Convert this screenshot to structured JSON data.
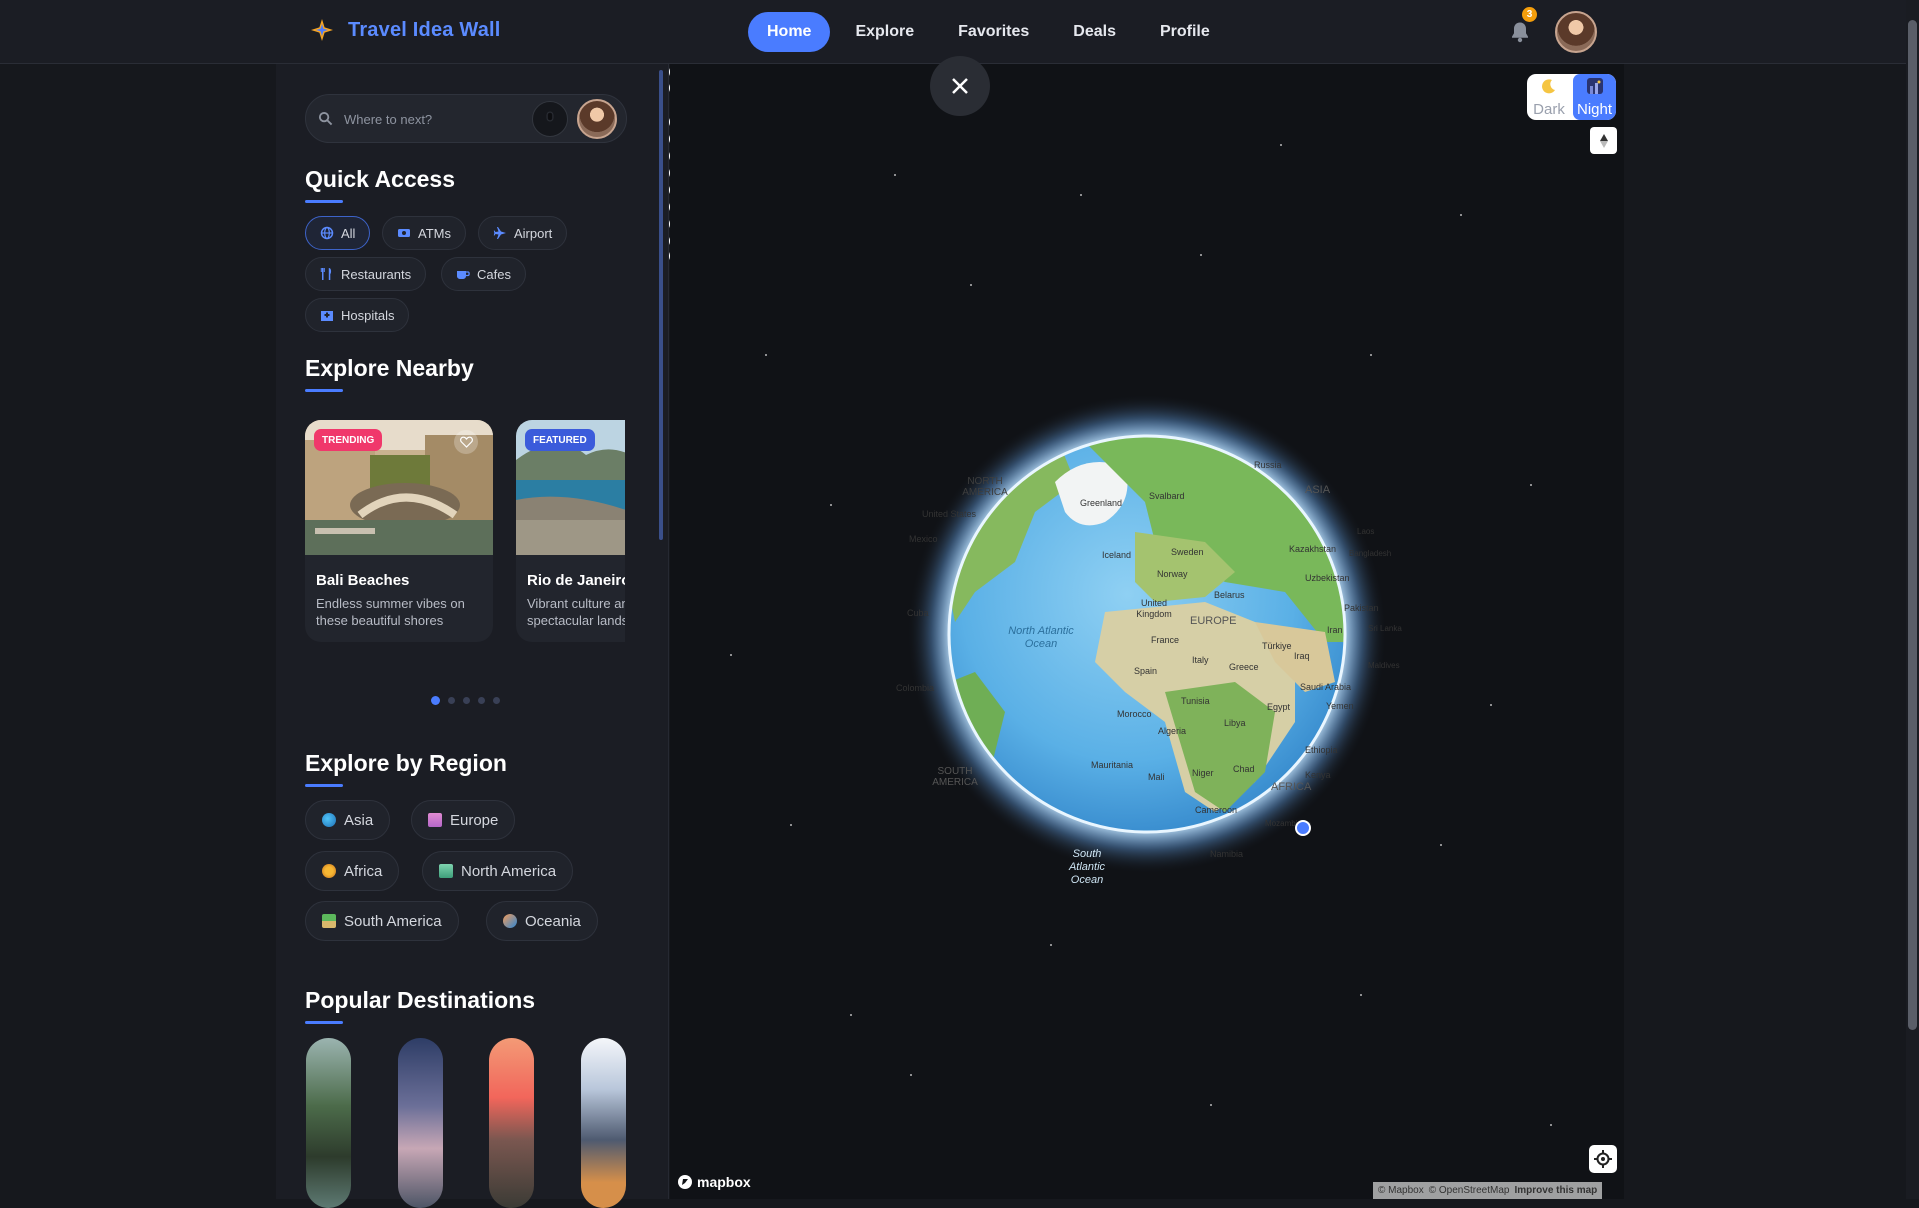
{
  "app": {
    "title": "Travel Idea Wall"
  },
  "nav": {
    "items": [
      {
        "label": "Home",
        "active": true
      },
      {
        "label": "Explore",
        "active": false
      },
      {
        "label": "Favorites",
        "active": false
      },
      {
        "label": "Deals",
        "active": false
      },
      {
        "label": "Profile",
        "active": false
      }
    ],
    "notifications": "3"
  },
  "search": {
    "placeholder": "Where to next?"
  },
  "quick_access": {
    "title": "Quick Access",
    "chips": [
      {
        "label": "All",
        "icon": "globe-icon",
        "active": true
      },
      {
        "label": "ATMs",
        "icon": "cash-icon",
        "active": false
      },
      {
        "label": "Airport",
        "icon": "plane-icon",
        "active": false
      },
      {
        "label": "Restaurants",
        "icon": "utensils-icon",
        "active": false
      },
      {
        "label": "Cafes",
        "icon": "coffee-icon",
        "active": false
      },
      {
        "label": "Hospitals",
        "icon": "hospital-icon",
        "active": false
      }
    ]
  },
  "explore_nearby": {
    "title": "Explore Nearby",
    "cards": [
      {
        "tag": "TRENDING",
        "tag_color": "#f0386b",
        "title": "Bali Beaches",
        "desc": "Endless summer vibes on these beautiful shores"
      },
      {
        "tag": "FEATURED",
        "tag_color": "#3b5bdb",
        "title": "Rio de Janeiro",
        "desc": "Vibrant culture and spectacular landscapes"
      }
    ],
    "page_count": 5,
    "current_page": 1
  },
  "regions": {
    "title": "Explore by Region",
    "items": [
      {
        "label": "Asia",
        "icon": "asia-globe-icon"
      },
      {
        "label": "Europe",
        "icon": "castle-icon"
      },
      {
        "label": "Africa",
        "icon": "lion-icon"
      },
      {
        "label": "North America",
        "icon": "statue-of-liberty-icon"
      },
      {
        "label": "South America",
        "icon": "palm-tree-icon"
      },
      {
        "label": "Oceania",
        "icon": "surfer-icon"
      }
    ]
  },
  "popular": {
    "title": "Popular Destinations"
  },
  "map": {
    "style_options": [
      {
        "label": "Dark",
        "icon": "moon-icon"
      },
      {
        "label": "Night",
        "icon": "night-city-icon"
      }
    ],
    "brand": "mapbox",
    "attribution": [
      "© Mapbox",
      "© OpenStreetMap",
      "Improve this map"
    ],
    "labels": {
      "north_america": "NORTH AMERICA",
      "united_states": "United States",
      "mexico": "Mexico",
      "cuba": "Cuba",
      "colombia": "Colombia",
      "south_america": "SOUTH AMERICA",
      "greenland": "Greenland",
      "svalbard": "Svalbard",
      "russia": "Russia",
      "asia": "ASIA",
      "iceland": "Iceland",
      "sweden": "Sweden",
      "norway": "Norway",
      "kazakhstan": "Kazakhstan",
      "laos": "Laos",
      "bangladesh": "Bangladesh",
      "uzbekistan": "Uzbekistan",
      "united_kingdom": "United Kingdom",
      "belarus": "Belarus",
      "europe": "EUROPE",
      "pakistan": "Pakistan",
      "north_atlantic": "North Atlantic Ocean",
      "france": "France",
      "italy": "Italy",
      "turkiye": "Türkiye",
      "iran": "Iran",
      "sri_lanka": "Sri Lanka",
      "spain": "Spain",
      "greece": "Greece",
      "iraq": "Iraq",
      "maldives": "Maldives",
      "saudi_arabia": "Saudi Arabia",
      "tunisia": "Tunisia",
      "egypt": "Egypt",
      "yemen": "Yemen",
      "morocco": "Morocco",
      "libya": "Libya",
      "algeria": "Algeria",
      "ethiopia": "Ethiopia",
      "mauritania": "Mauritania",
      "mali": "Mali",
      "niger": "Niger",
      "chad": "Chad",
      "africa": "AFRICA",
      "kenya": "Kenya",
      "cameroon": "Cameroon",
      "mozambique": "Mozambique",
      "namibia": "Namibia",
      "south_atlantic": "South Atlantic Ocean"
    }
  },
  "colors": {
    "accent": "#4a7cff",
    "trending": "#f0386b",
    "featured": "#3b5bdb",
    "badge": "#f59e0b"
  }
}
